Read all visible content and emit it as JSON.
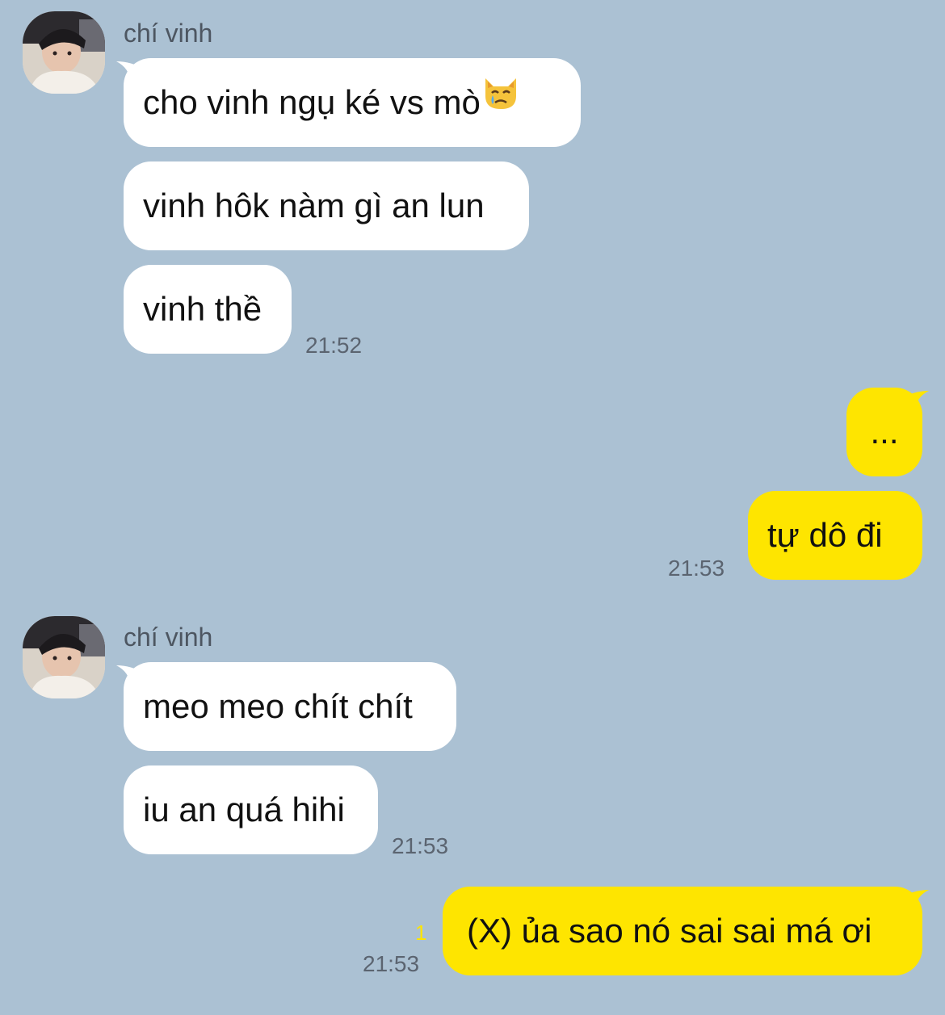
{
  "sender": {
    "name": "chí vinh"
  },
  "messages": [
    {
      "text": "cho vinh ngụ ké vs mò",
      "emoji": "crying-cat-face"
    },
    {
      "text": "vinh hôk nàm gì an lun"
    },
    {
      "text": "vinh thề",
      "time": "21:52"
    },
    {
      "text": "..."
    },
    {
      "text": "tự dô đi",
      "time": "21:53"
    },
    {
      "text": "meo meo chít chít"
    },
    {
      "text": "iu an quá hihi",
      "time": "21:53"
    },
    {
      "text": "(X) ủa sao nó sai sai má ơi",
      "time": "21:53",
      "unread": "1"
    }
  ],
  "colors": {
    "background": "#abc1d3",
    "incoming": "#ffffff",
    "outgoing": "#fee500",
    "unread": "#fee500"
  }
}
